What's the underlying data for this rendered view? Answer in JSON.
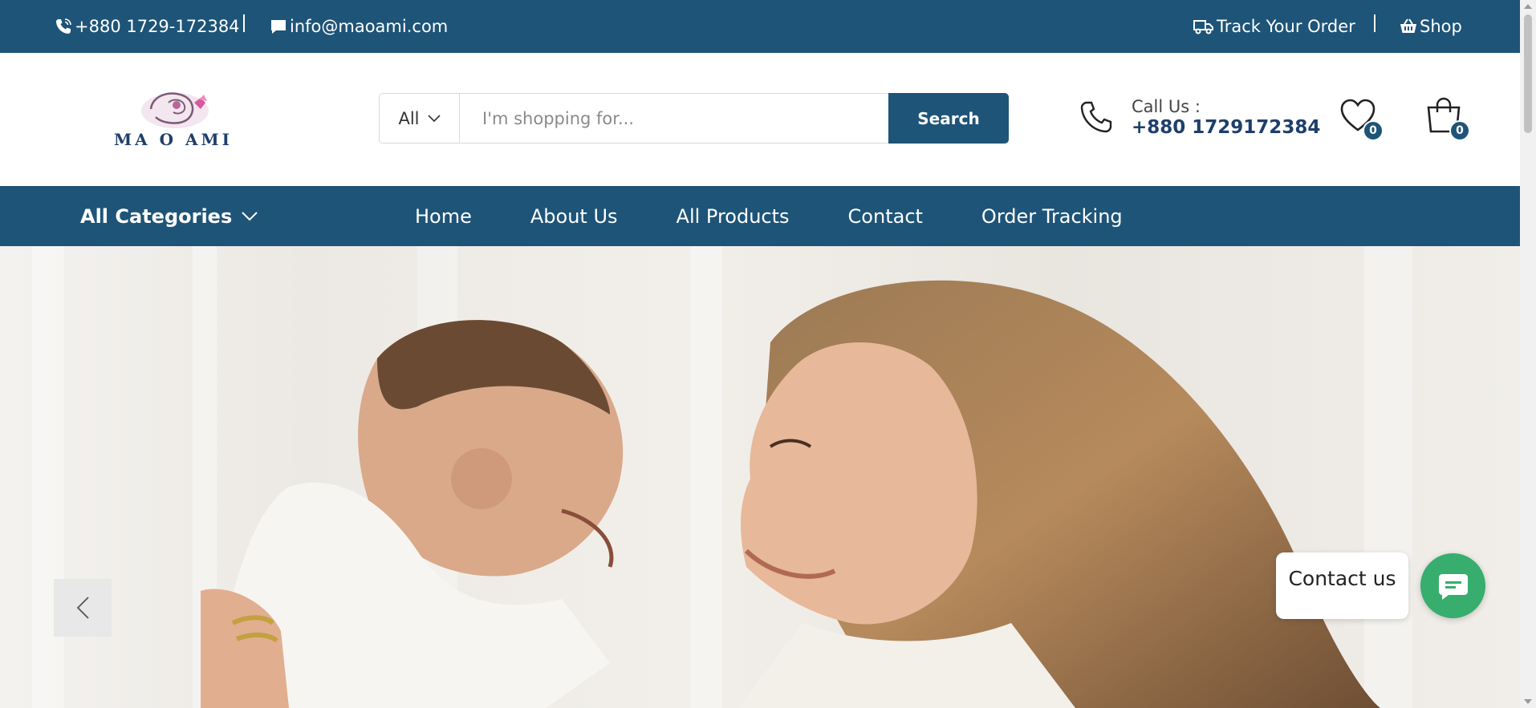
{
  "topbar": {
    "phone": "+880 1729-172384",
    "email": "info@maoami.com",
    "track_order": "Track Your Order",
    "shop": "Shop"
  },
  "header": {
    "logo_text": "MA O AMI",
    "search": {
      "category": "All",
      "placeholder": "I'm shopping for...",
      "button": "Search"
    },
    "call_label": "Call Us :",
    "call_number": "+880 1729172384",
    "wishlist_count": "0",
    "cart_count": "0"
  },
  "nav": {
    "categories_label": "All Categories",
    "links": [
      "Home",
      "About Us",
      "All Products",
      "Contact",
      "Order Tracking"
    ]
  },
  "widget": {
    "contact_label": "Contact us"
  },
  "colors": {
    "brand": "#1e5478",
    "contact_green": "#37ad6e"
  }
}
